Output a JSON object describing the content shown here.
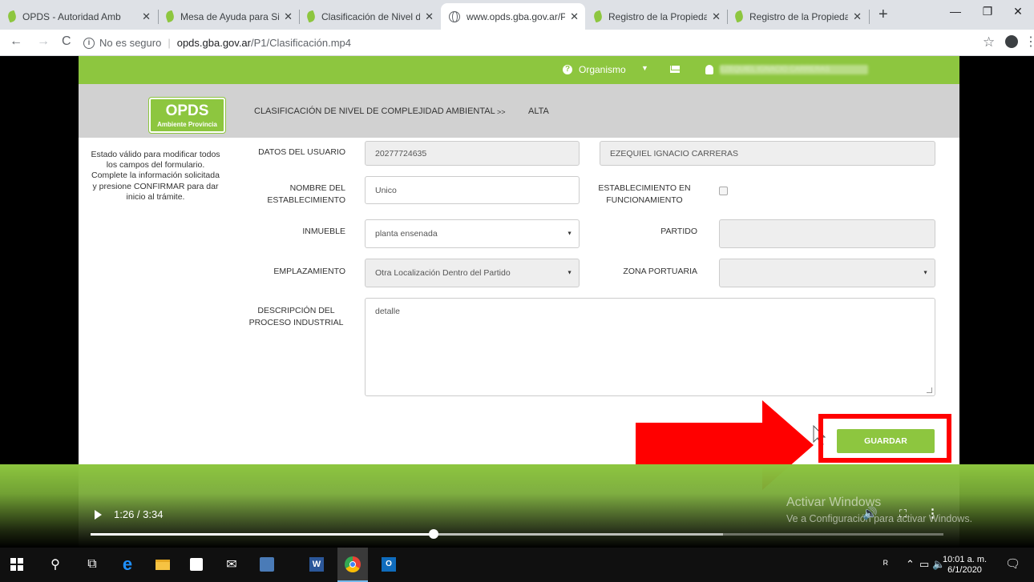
{
  "browser": {
    "tabs": [
      {
        "title": "OPDS - Autoridad Amb",
        "favicon": "leaf-icon",
        "active": false
      },
      {
        "title": "Mesa de Ayuda para Si",
        "favicon": "leaf-icon",
        "active": false
      },
      {
        "title": "Clasificación de Nivel d",
        "favicon": "leaf-icon",
        "active": false
      },
      {
        "title": "www.opds.gba.gov.ar/P",
        "favicon": "globe-icon",
        "active": true
      },
      {
        "title": "Registro de la Propieda",
        "favicon": "leaf-icon",
        "active": false
      },
      {
        "title": "Registro de la Propieda",
        "favicon": "leaf-icon",
        "active": false
      }
    ],
    "close_glyph": "✕",
    "new_tab_glyph": "+",
    "security_label": "No es seguro",
    "url_host": "opds.gba.gov.ar",
    "url_path": "/P1/Clasificación.mp4"
  },
  "site": {
    "header": {
      "help_glyph": "?",
      "organismo_label": "Organismo",
      "user_name": "EZEQUIEL IGNACIO CARRERAS"
    },
    "logo": {
      "main": "OPDS",
      "sub": "Ambiente Provincia"
    },
    "breadcrumb": {
      "section": "CLASIFICACIÓN DE NIVEL DE COMPLEJIDAD AMBIENTAL",
      "separator": ">>",
      "current": "ALTA"
    },
    "help_text": "Estado válido para modificar todos los campos del formulario. Complete la información solicitada y presione CONFIRMAR para dar inicio al trámite.",
    "form": {
      "datos_usuario_label": "DATOS DEL USUARIO",
      "cuit_value": "20277724635",
      "user_full_name": "EZEQUIEL IGNACIO CARRERAS",
      "nombre_establecimiento_label": "NOMBRE DEL ESTABLECIMIENTO",
      "nombre_establecimiento_value": "Unico",
      "en_funcionamiento_label": "ESTABLECIMIENTO EN FUNCIONAMIENTO",
      "en_funcionamiento_checked": false,
      "inmueble_label": "INMUEBLE",
      "inmueble_value": "planta ensenada",
      "partido_label": "PARTIDO",
      "partido_value": "",
      "emplazamiento_label": "EMPLAZAMIENTO",
      "emplazamiento_value": "Otra Localización Dentro del Partido",
      "zona_portuaria_label": "ZONA PORTUARIA",
      "zona_portuaria_value": "",
      "descripcion_label": "DESCRIPCIÓN DEL PROCESO INDUSTRIAL",
      "descripcion_value": "detalle",
      "save_button": "GUARDAR"
    }
  },
  "video": {
    "time": "1:26 / 3:34",
    "progress_fraction": 0.402,
    "buffered_fraction": 0.742,
    "watermark_title": "Activar Windows",
    "watermark_sub": "Ve a Configuración para activar Windows."
  },
  "taskbar": {
    "clock_time": "10:01 a. m.",
    "clock_date": "6/1/2020"
  },
  "colors": {
    "brand_green": "#8dc63f",
    "highlight_red": "#ff0000"
  }
}
